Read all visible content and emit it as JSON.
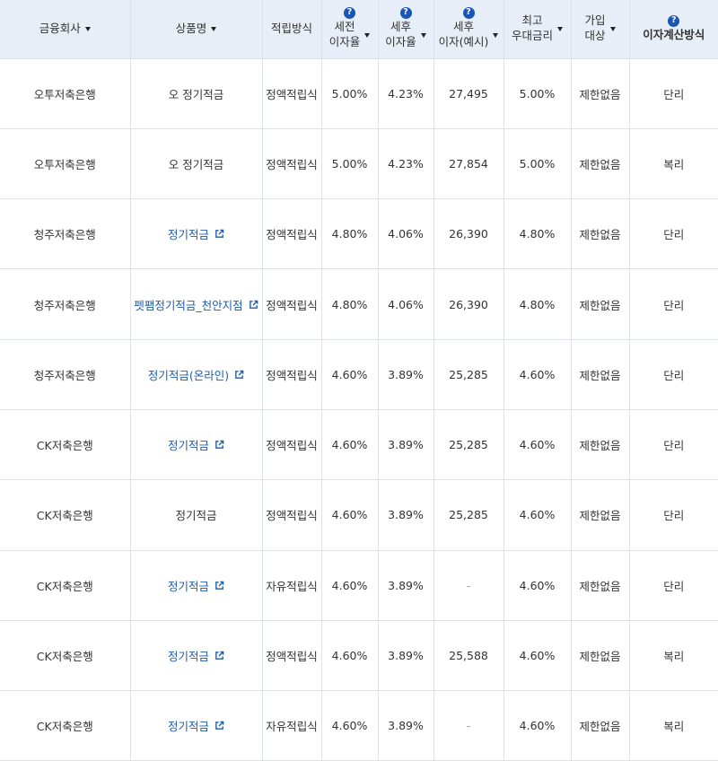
{
  "header": {
    "bank": "금융회사",
    "product": "상품명",
    "method": "적립방식",
    "pretax": [
      "세전",
      "이자율"
    ],
    "aftertax": [
      "세후",
      "이자율"
    ],
    "aftertax_interest": [
      "세후",
      "이자(예시)"
    ],
    "max_rate": [
      "최고",
      "우대금리"
    ],
    "eligibility": [
      "가입",
      "대상"
    ],
    "calc": "이자계산방식"
  },
  "help_glyph": "?",
  "rows": [
    {
      "bank": "오투저축은행",
      "product": "오 정기적금",
      "link": false,
      "method": "정액적립식",
      "pretax": "5.00%",
      "aftertax": "4.23%",
      "interest": "27,495",
      "max_rate": "5.00%",
      "eligibility": "제한없음",
      "calc": "단리"
    },
    {
      "bank": "오투저축은행",
      "product": "오 정기적금",
      "link": false,
      "method": "정액적립식",
      "pretax": "5.00%",
      "aftertax": "4.23%",
      "interest": "27,854",
      "max_rate": "5.00%",
      "eligibility": "제한없음",
      "calc": "복리"
    },
    {
      "bank": "청주저축은행",
      "product": "정기적금",
      "link": true,
      "method": "정액적립식",
      "pretax": "4.80%",
      "aftertax": "4.06%",
      "interest": "26,390",
      "max_rate": "4.80%",
      "eligibility": "제한없음",
      "calc": "단리"
    },
    {
      "bank": "청주저축은행",
      "product": "펫팸정기적금_천안지점",
      "link": true,
      "method": "정액적립식",
      "pretax": "4.80%",
      "aftertax": "4.06%",
      "interest": "26,390",
      "max_rate": "4.80%",
      "eligibility": "제한없음",
      "calc": "단리"
    },
    {
      "bank": "청주저축은행",
      "product": "정기적금(온라인)",
      "link": true,
      "method": "정액적립식",
      "pretax": "4.60%",
      "aftertax": "3.89%",
      "interest": "25,285",
      "max_rate": "4.60%",
      "eligibility": "제한없음",
      "calc": "단리"
    },
    {
      "bank": "CK저축은행",
      "product": "정기적금",
      "link": true,
      "method": "정액적립식",
      "pretax": "4.60%",
      "aftertax": "3.89%",
      "interest": "25,285",
      "max_rate": "4.60%",
      "eligibility": "제한없음",
      "calc": "단리"
    },
    {
      "bank": "CK저축은행",
      "product": "정기적금",
      "link": false,
      "method": "정액적립식",
      "pretax": "4.60%",
      "aftertax": "3.89%",
      "interest": "25,285",
      "max_rate": "4.60%",
      "eligibility": "제한없음",
      "calc": "단리"
    },
    {
      "bank": "CK저축은행",
      "product": "정기적금",
      "link": true,
      "method": "자유적립식",
      "pretax": "4.60%",
      "aftertax": "3.89%",
      "interest": "-",
      "max_rate": "4.60%",
      "eligibility": "제한없음",
      "calc": "단리"
    },
    {
      "bank": "CK저축은행",
      "product": "정기적금",
      "link": true,
      "method": "정액적립식",
      "pretax": "4.60%",
      "aftertax": "3.89%",
      "interest": "25,588",
      "max_rate": "4.60%",
      "eligibility": "제한없음",
      "calc": "복리"
    },
    {
      "bank": "CK저축은행",
      "product": "정기적금",
      "link": true,
      "method": "자유적립식",
      "pretax": "4.60%",
      "aftertax": "3.89%",
      "interest": "-",
      "max_rate": "4.60%",
      "eligibility": "제한없음",
      "calc": "복리"
    }
  ]
}
